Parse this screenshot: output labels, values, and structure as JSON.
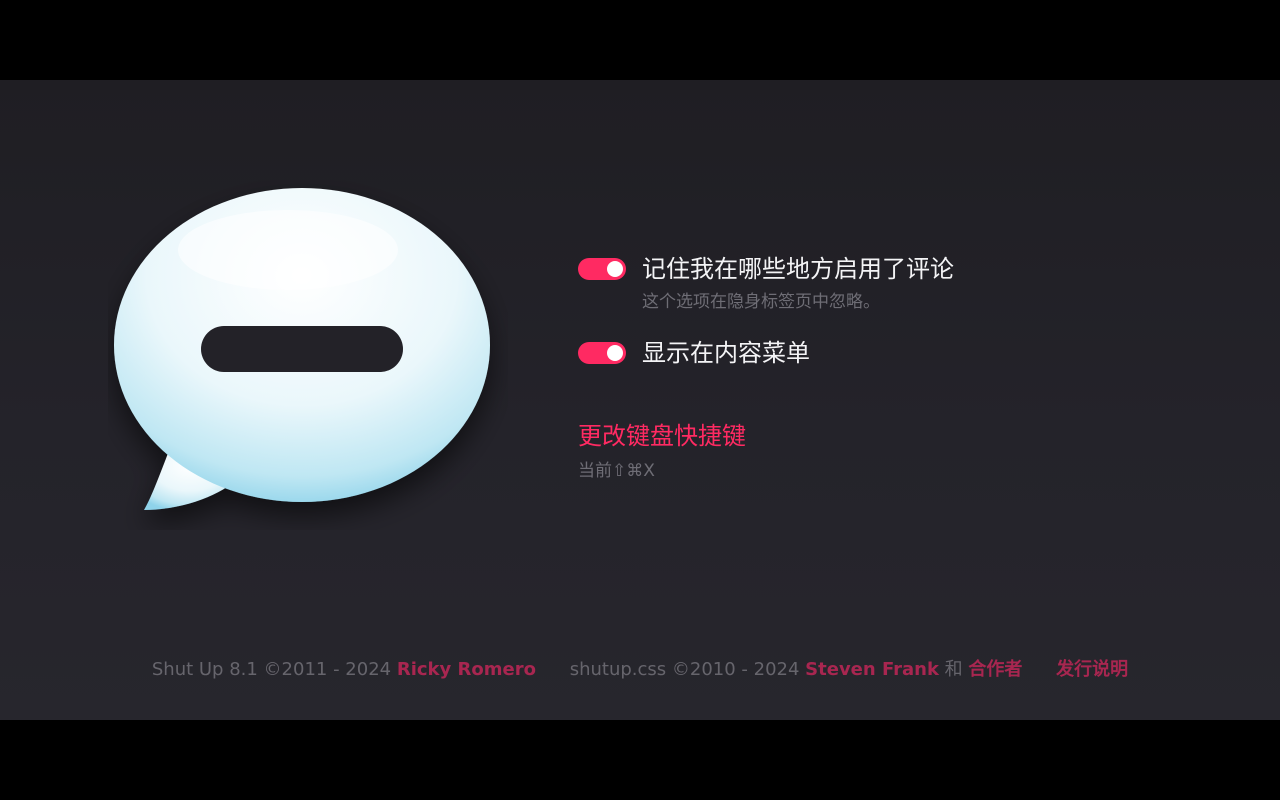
{
  "options": [
    {
      "label": "记住我在哪些地方启用了评论",
      "sublabel": "这个选项在隐身标签页中忽略。",
      "enabled": true
    },
    {
      "label": "显示在内容菜单",
      "enabled": true
    }
  ],
  "shortcut": {
    "link_label": "更改键盘快捷键",
    "current": "当前⇧⌘X"
  },
  "footer": {
    "app_credit": "Shut Up 8.1 ©2011 - 2024",
    "app_author": "Ricky Romero",
    "css_credit": "shutup.css ©2010 - 2024",
    "css_author": "Steven Frank",
    "and_word": "和",
    "contributors": "合作者",
    "release_notes": "发行说明"
  },
  "colors": {
    "accent": "#ff2a62",
    "footer_link": "#a82650",
    "background": "#232228",
    "muted_text": "#6e6d75"
  },
  "icons": {
    "logo": "speech-bubble-logo-icon"
  }
}
